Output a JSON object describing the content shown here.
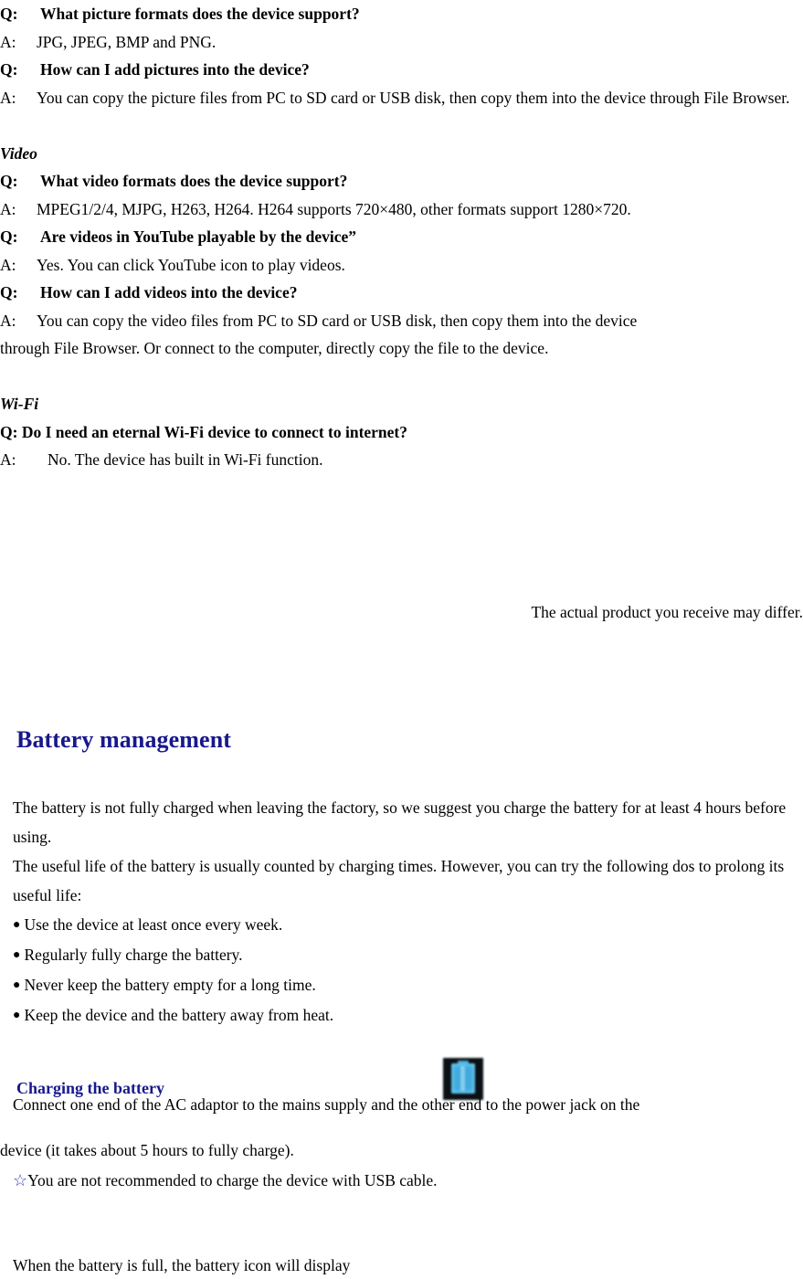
{
  "document": {
    "faq": {
      "picture_section": [
        {
          "type": "q",
          "label": "Q:",
          "text": "What picture formats does the device support?"
        },
        {
          "type": "a",
          "label": "A:",
          "text": "JPG, JPEG, BMP and PNG."
        },
        {
          "type": "q",
          "label": "Q:",
          "text": "How can I add pictures into the device?"
        },
        {
          "type": "a",
          "label": "A:",
          "text": "You can copy the picture files from PC to SD card or USB disk, then copy them into the device through File Browser."
        }
      ],
      "video_section": {
        "heading": "Video",
        "items": [
          {
            "type": "q",
            "label": "Q:",
            "text": "What video formats does the device support?"
          },
          {
            "type": "a",
            "label": "A:",
            "text": "MPEG1/2/4, MJPG, H263, H264. H264 supports 720×480, other formats support 1280×720."
          },
          {
            "type": "q",
            "label": "Q:",
            "text": "Are videos in YouTube playable by the device”"
          },
          {
            "type": "a",
            "label": "A:",
            "text": "Yes. You can click YouTube icon to play videos."
          },
          {
            "type": "q",
            "label": "Q:",
            "text": "How can I add videos into the device?"
          },
          {
            "type": "a",
            "label": "A:",
            "text": "You can copy the video files from PC to SD card or USB disk, then copy them into the device"
          }
        ],
        "continuation": "through File Browser. Or connect to the computer, directly copy the file to the device."
      },
      "wifi_section": {
        "heading": "Wi-Fi",
        "question": "Q: Do I need an eternal Wi-Fi device to connect to internet?",
        "answer_label": "A:",
        "answer_text": "No. The device has built in Wi-Fi function."
      }
    },
    "notice": "The actual product you receive may differ.",
    "battery": {
      "heading": "Battery management",
      "heading_color": "#18188c",
      "paragraphs": [
        "The battery is not fully charged when leaving the factory, so we suggest you charge the battery for at least 4 hours before using.",
        "The useful life of the battery is usually counted by charging times. However, you can try the following dos to prolong its useful life:"
      ],
      "bullet_char": "●",
      "bullets": [
        "Use the device at least once every week.",
        "Regularly fully charge the battery.",
        "Never keep the battery empty for a long time.",
        "Keep the device and the battery away from heat."
      ],
      "charging": {
        "heading": "Charging the battery",
        "heading_color": "#18188c",
        "line1": "Connect one end of the AC adaptor to the mains supply and the other end to the power jack on the",
        "line2": "device (it takes about 5 hours to fully charge).",
        "star_char": "☆",
        "star_color": "#3b3bbf",
        "line3": "You are not recommended to charge the device with USB cable.",
        "icon_name": "battery-charging-icon"
      },
      "battery_full_line": "When the battery is full, the battery icon will display"
    }
  }
}
